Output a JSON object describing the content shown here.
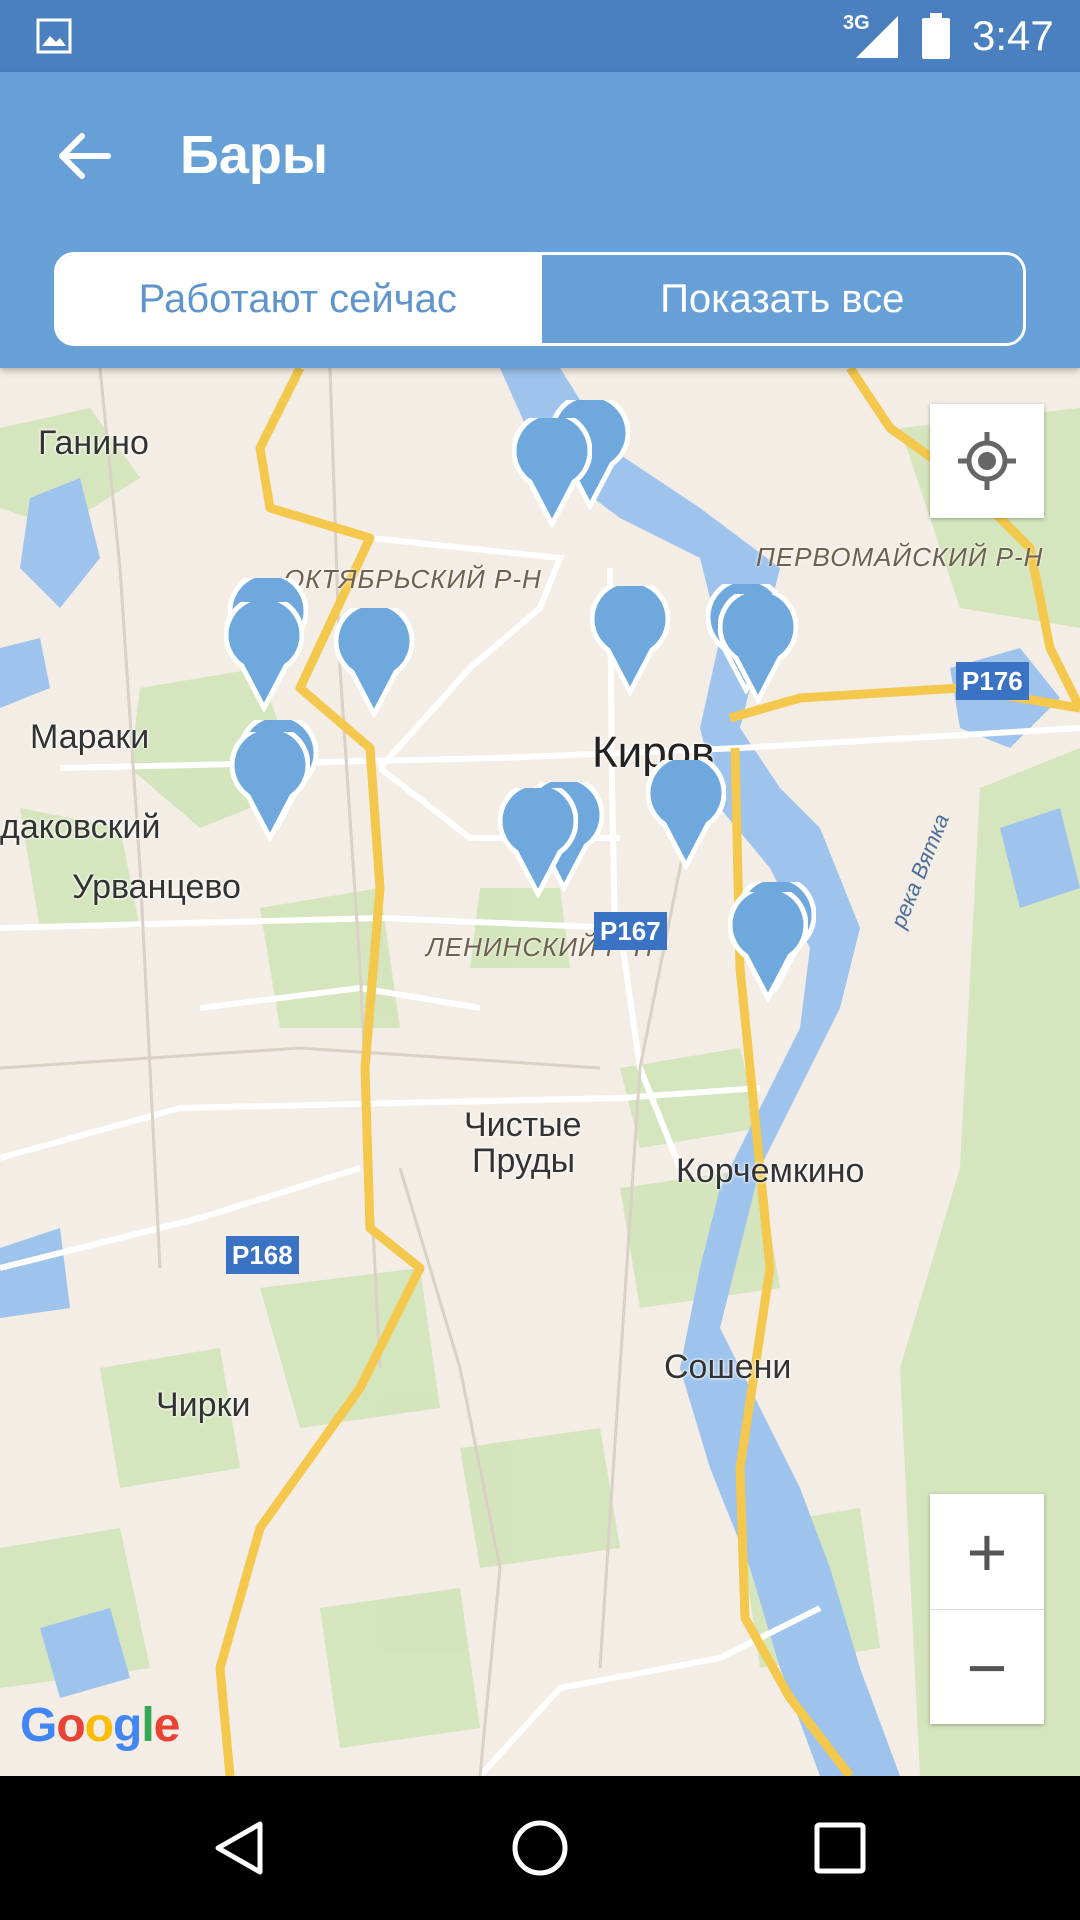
{
  "status_bar": {
    "network": "3G",
    "time": "3:47",
    "icons": [
      "image-icon",
      "signal-icon",
      "battery-icon"
    ]
  },
  "app_bar": {
    "title": "Бары",
    "back_icon": "arrow-back-icon",
    "segments": [
      {
        "label": "Работают сейчас",
        "active": true
      },
      {
        "label": "Показать все",
        "active": false
      }
    ],
    "colors": {
      "primary": "#66a0d6",
      "status": "#4a80c0"
    }
  },
  "map": {
    "places": [
      "Ганино",
      "Мараки",
      "дaковский",
      "Урванцево",
      "Киров",
      "Чистые",
      "Пруды",
      "Корчемкино",
      "Сошени",
      "Чирки"
    ],
    "districts": [
      "ОКТЯБРЬСКИЙ Р-Н",
      "ПЕРВОМАЙСКИЙ Р-Н",
      "ЛЕНИНСКИЙ Р-Н"
    ],
    "river": "река Вятка",
    "road_shields": [
      "Р176",
      "Р167",
      "Р168"
    ],
    "pin_color": "#6fa8dc",
    "pin_count": 17,
    "controls": {
      "locate_icon": "my-location-icon",
      "zoom_in": "+",
      "zoom_out": "−"
    },
    "attribution": "Google"
  },
  "nav_bar": {
    "icons": [
      "back-triangle-icon",
      "home-circle-icon",
      "recents-square-icon"
    ]
  }
}
